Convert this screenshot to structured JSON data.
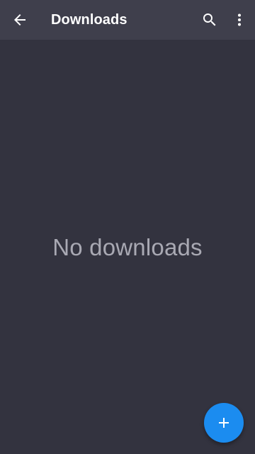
{
  "appbar": {
    "title": "Downloads",
    "back_icon": "arrow-back-icon",
    "search_icon": "search-icon",
    "more_icon": "more-vert-icon"
  },
  "main": {
    "empty_message": "No downloads"
  },
  "fab": {
    "icon": "plus-icon"
  },
  "colors": {
    "background": "#33333f",
    "appbar": "#3f3f4c",
    "accent": "#1b8cf0",
    "empty_text": "#a9a9b3"
  }
}
